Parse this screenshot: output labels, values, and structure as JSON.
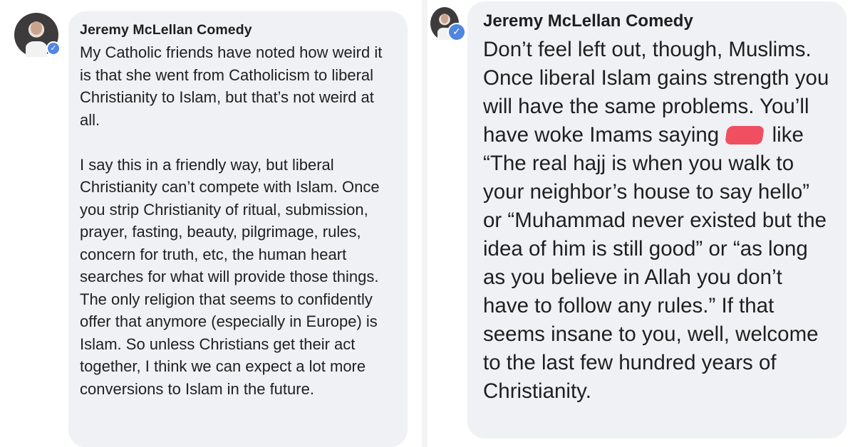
{
  "left_post": {
    "author": "Jeremy McLellan Comedy",
    "paragraph_1": "My Catholic friends have noted how weird it is that she went from Catholicism to liberal Christianity to Islam, but that’s not weird at all.",
    "paragraph_2": "I say this in a friendly way, but liberal Christianity can’t compete with Islam. Once you strip Christianity of ritual, submission, prayer, fasting, beauty, pilgrimage, rules, concern for truth, etc, the human heart searches for what will provide those things. The only religion that seems to confidently offer that anymore (especially in Europe) is Islam. So unless Christians get their act together, I think we can expect a lot more conversions to Islam in the future."
  },
  "right_post": {
    "author": "Jeremy McLellan Comedy",
    "text_before_censor": "Don’t feel left out, though, Muslims. Once liberal Islam gains strength you will have the same problems. You’ll have woke Imams saying",
    "text_after_censor": "like “The real hajj is when you walk to your neighbor’s house to say hello” or “Muhammad never existed but the idea of him is still good” or “as long as you believe in Allah you don’t have to follow any rules.” If that seems insane to you, well, welcome to the last few hundred years of Christianity."
  },
  "icons": {
    "verified": "verified-badge-icon",
    "censor": "red-censor-mark"
  },
  "colors": {
    "bubble_bg": "#f0f1f4",
    "verified_blue": "#4f86e0",
    "censor_red": "#ef4f61",
    "text": "#1f1f1f"
  }
}
